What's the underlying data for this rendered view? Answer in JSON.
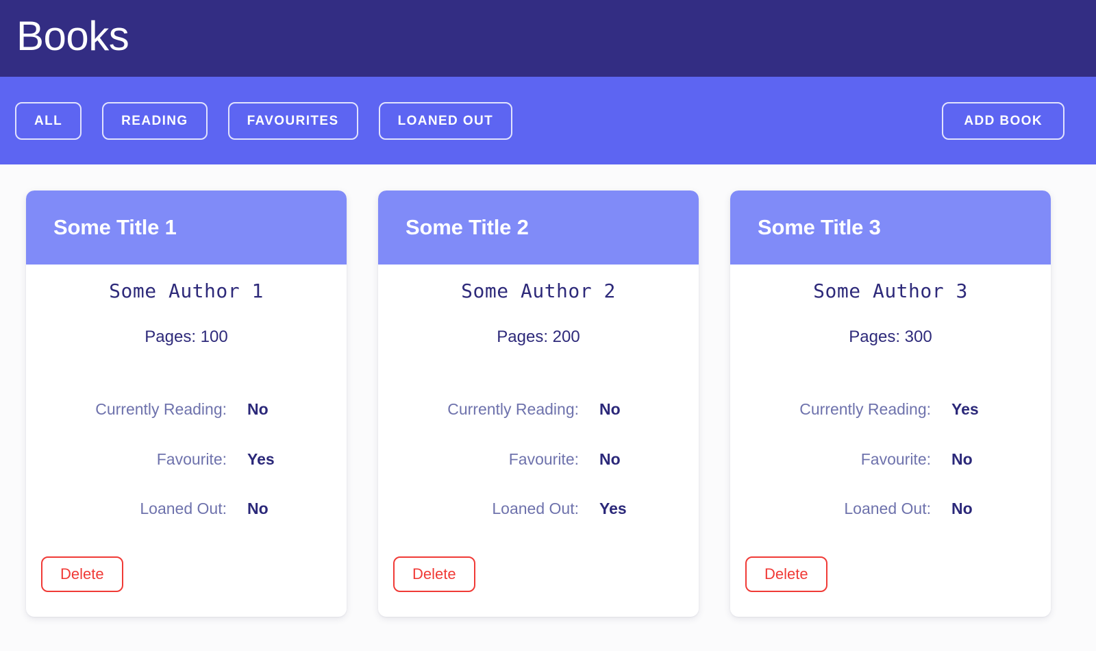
{
  "header": {
    "title": "Books"
  },
  "nav": {
    "filters": [
      {
        "label": "ALL",
        "name": "all"
      },
      {
        "label": "READING",
        "name": "reading"
      },
      {
        "label": "FAVOURITES",
        "name": "favourites"
      },
      {
        "label": "LOANED OUT",
        "name": "loaned-out"
      }
    ],
    "add_book_label": "ADD BOOK"
  },
  "labels": {
    "currently_reading": "Currently Reading:",
    "favourite": "Favourite:",
    "loaned_out": "Loaned Out:",
    "pages_prefix": "Pages:",
    "delete": "Delete"
  },
  "colors": {
    "header_bg": "#332D83",
    "nav_bg": "#5D65F2",
    "card_header_bg": "#808BF8",
    "page_bg": "#fbfbfc",
    "text_dark": "#2B2879",
    "text_muted": "#6E72AC",
    "danger": "#F03A36",
    "white": "#FFFFFF"
  },
  "books": [
    {
      "title": "Some Title 1",
      "author": "Some Author 1",
      "pages": "Pages: 100",
      "currently_reading": "No",
      "favourite": "Yes",
      "loaned_out": "No",
      "delete_label": "Delete"
    },
    {
      "title": "Some Title 2",
      "author": "Some Author 2",
      "pages": "Pages: 200",
      "currently_reading": "No",
      "favourite": "No",
      "loaned_out": "Yes",
      "delete_label": "Delete"
    },
    {
      "title": "Some Title 3",
      "author": "Some Author 3",
      "pages": "Pages: 300",
      "currently_reading": "Yes",
      "favourite": "No",
      "loaned_out": "No",
      "delete_label": "Delete"
    }
  ]
}
